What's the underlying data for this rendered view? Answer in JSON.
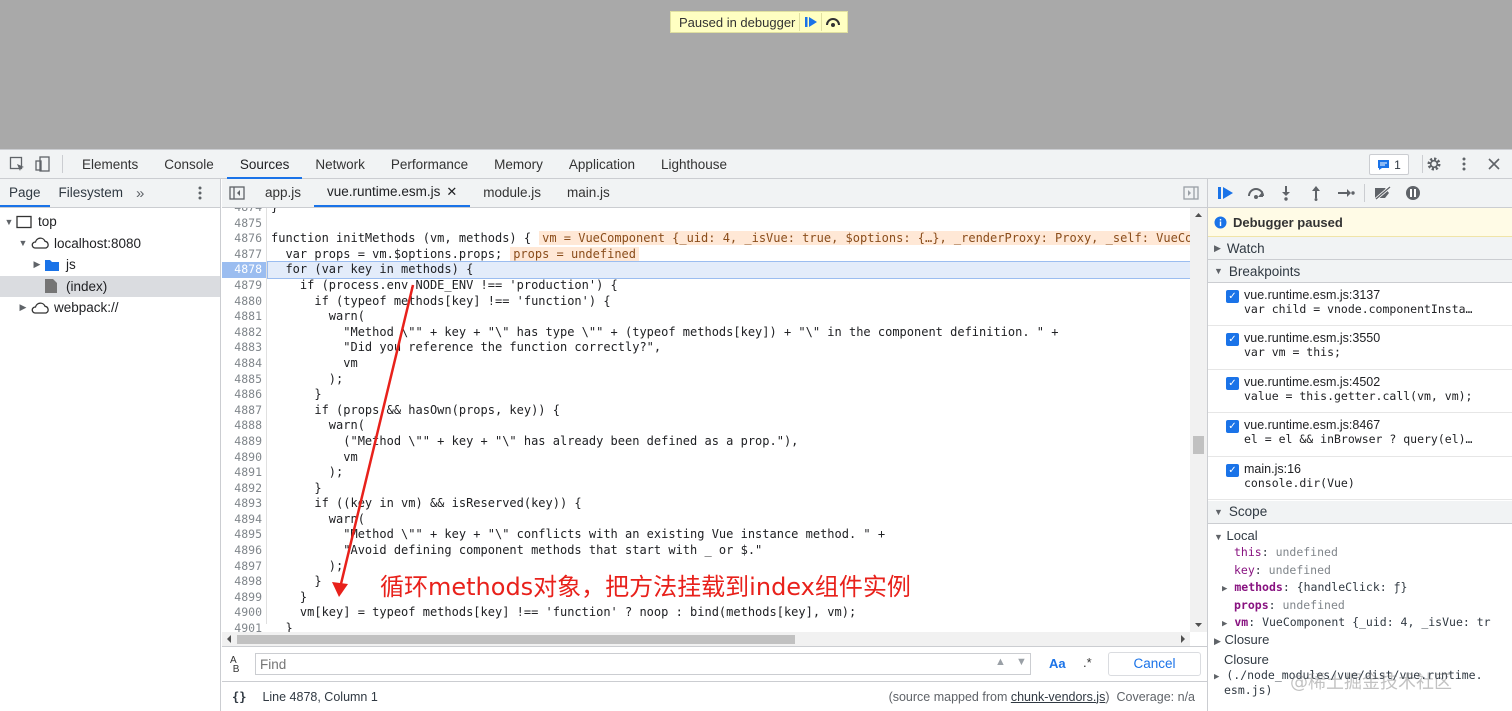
{
  "banner": {
    "label": "Paused in debugger"
  },
  "topbar": {
    "tabs": [
      "Elements",
      "Console",
      "Sources",
      "Network",
      "Performance",
      "Memory",
      "Application",
      "Lighthouse"
    ],
    "active_tab": "Sources",
    "message_count": "1"
  },
  "navigator": {
    "tabs": [
      "Page",
      "Filesystem"
    ],
    "tree": [
      {
        "label": "top",
        "depth": 0,
        "icon": "frame-icon",
        "expanded": true
      },
      {
        "label": "localhost:8080",
        "depth": 1,
        "icon": "cloud-icon",
        "expanded": true
      },
      {
        "label": "js",
        "depth": 2,
        "icon": "folder-icon",
        "expanded": false
      },
      {
        "label": "(index)",
        "depth": 2,
        "icon": "file-icon",
        "selected": true
      },
      {
        "label": "webpack://",
        "depth": 1,
        "icon": "cloud-icon",
        "expanded": false
      }
    ]
  },
  "editor": {
    "tabs": [
      "app.js",
      "vue.runtime.esm.js",
      "module.js",
      "main.js"
    ],
    "active_tab": "vue.runtime.esm.js",
    "line_numbers": [
      "4874",
      "4875",
      "4876",
      "4877",
      "4878",
      "4879",
      "4880",
      "4881",
      "4882",
      "4883",
      "4884",
      "4885",
      "4886",
      "4887",
      "4888",
      "4889",
      "4890",
      "4891",
      "4892",
      "4893",
      "4894",
      "4895",
      "4896",
      "4897",
      "4898",
      "4899",
      "4900",
      "4901"
    ],
    "lines": [
      "}",
      "",
      "function initMethods (vm, methods) {",
      "  var props = vm.$options.props;",
      "  for (var key in methods) {",
      "    if (process.env.NODE_ENV !== 'production') {",
      "      if (typeof methods[key] !== 'function') {",
      "        warn(",
      "          \"Method \\\"\" + key + \"\\\" has type \\\"\" + (typeof methods[key]) + \"\\\" in the component definition. \" +",
      "          \"Did you reference the function correctly?\",",
      "          vm",
      "        );",
      "      }",
      "      if (props && hasOwn(props, key)) {",
      "        warn(",
      "          (\"Method \\\"\" + key + \"\\\" has already been defined as a prop.\"),",
      "          vm",
      "        );",
      "      }",
      "      if ((key in vm) && isReserved(key)) {",
      "        warn(",
      "          \"Method \\\"\" + key + \"\\\" conflicts with an existing Vue instance method. \" +",
      "          \"Avoid defining component methods that start with _ or $.\"",
      "        );",
      "      }",
      "    }",
      "    vm[key] = typeof methods[key] !== 'function' ? noop : bind(methods[key], vm);",
      "  }"
    ],
    "inline_values": {
      "line_4876": "vm = VueComponent {_uid: 4, _isVue: true, $options: {…}, _renderProxy: Proxy, _self: VueCom",
      "line_4877": "props = undefined"
    },
    "execution_line": "4878",
    "find_placeholder": "Find",
    "find_match_case": "Aa",
    "find_regex": ".*",
    "find_cancel": "Cancel",
    "status_position": "Line 4878, Column 1",
    "status_source_prefix": "(source mapped from ",
    "status_source_file": "chunk-vendors.js",
    "status_source_suffix": ")",
    "status_coverage": "Coverage: n/a"
  },
  "debugger": {
    "paused_label": "Debugger paused",
    "watch_label": "Watch",
    "breakpoints_label": "Breakpoints",
    "breakpoints": [
      {
        "file": "vue.runtime.esm.js:3137",
        "code": "var child = vnode.componentInsta…"
      },
      {
        "file": "vue.runtime.esm.js:3550",
        "code": "var vm = this;"
      },
      {
        "file": "vue.runtime.esm.js:4502",
        "code": "value = this.getter.call(vm, vm);"
      },
      {
        "file": "vue.runtime.esm.js:8467",
        "code": "el = el && inBrowser ? query(el)…"
      },
      {
        "file": "main.js:16",
        "code": "console.dir(Vue)"
      }
    ],
    "scope_label": "Scope",
    "local_label": "Local",
    "locals": [
      {
        "key": "this",
        "value": "undefined"
      },
      {
        "key": "key",
        "value": "undefined"
      },
      {
        "key": "methods",
        "value": "{handleClick: ƒ}"
      },
      {
        "key": "props",
        "value": "undefined"
      },
      {
        "key": "vm",
        "value": "VueComponent {_uid: 4, _isVue: tr"
      }
    ],
    "closure_label": "Closure",
    "closure2_label": "Closure",
    "closure2_path": "(./node_modules/vue/dist/vue.runtime.",
    "closure2_path2": "esm.js)"
  },
  "annotation": "循环methods对象，把方法挂载到index组件实例",
  "watermark": "@稀土掘金技术社区",
  "colors": {
    "accent": "#1a73e8",
    "annotation": "#e8211b",
    "paused_bg": "#fffbe6"
  }
}
